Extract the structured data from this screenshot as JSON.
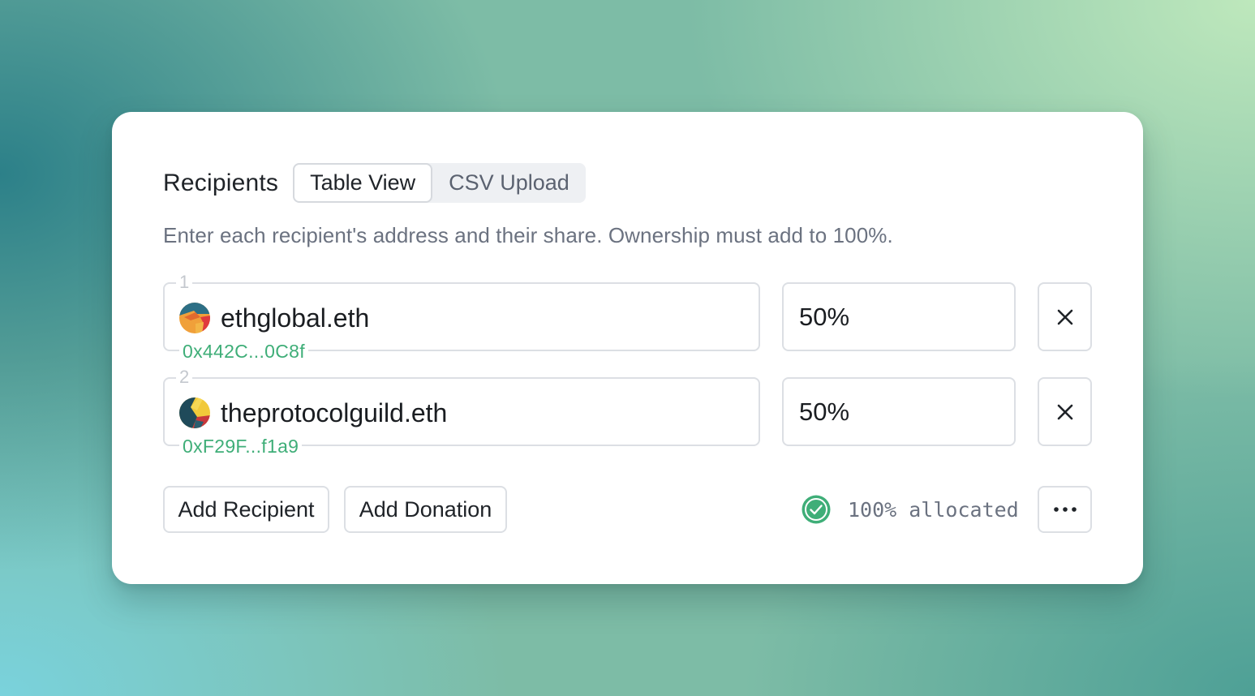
{
  "card": {
    "title": "Recipients",
    "tabs": [
      {
        "label": "Table View",
        "active": true
      },
      {
        "label": "CSV Upload",
        "active": false
      }
    ],
    "description": "Enter each recipient's address and their share. Ownership must add to 100%."
  },
  "recipients": [
    {
      "index": "1",
      "name": "ethglobal.eth",
      "address": "0x442C...0C8f",
      "share": "50%",
      "avatar": "ethglobal-avatar"
    },
    {
      "index": "2",
      "name": "theprotocolguild.eth",
      "address": "0xF29F...f1a9",
      "share": "50%",
      "avatar": "protocolguild-avatar"
    }
  ],
  "actions": {
    "add_recipient": "Add Recipient",
    "add_donation": "Add Donation",
    "more_icon": "ellipsis-icon",
    "remove_icon": "close-icon"
  },
  "status": {
    "text": "100% allocated",
    "icon": "check-circle-icon",
    "color": "#3fae78"
  },
  "colors": {
    "address_green": "#3fae78",
    "border": "#dcdfe4"
  }
}
